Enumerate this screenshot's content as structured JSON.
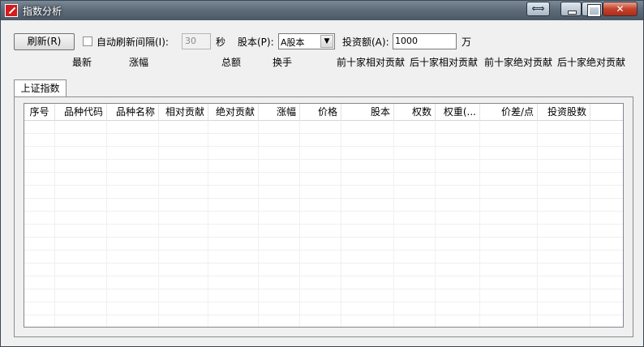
{
  "window": {
    "title": "指数分析"
  },
  "titlebar": {
    "restore_label": "⟺"
  },
  "toolbar": {
    "refresh_label": "刷新(R)",
    "auto_refresh_label": "自动刷新间隔(I):",
    "interval_value": "30",
    "seconds_label": "秒",
    "share_label": "股本(P):",
    "share_selected": "A股本",
    "invest_label": "投资额(A):",
    "invest_value": "1000",
    "unit_label": "万"
  },
  "stats": {
    "latest": "最新",
    "change": "涨幅",
    "total": "总额",
    "turnover": "换手",
    "top10_rel": "前十家相对贡献",
    "bottom10_rel": "后十家相对贡献",
    "top10_abs": "前十家绝对贡献",
    "bottom10_abs": "后十家绝对贡献"
  },
  "tabs": [
    {
      "label": "上证指数"
    }
  ],
  "table": {
    "columns": [
      "序号",
      "品种代码",
      "品种名称",
      "相对贡献",
      "绝对贡献",
      "涨幅",
      "价格",
      "股本",
      "权数",
      "权重(...",
      "价差/点",
      "投资股数"
    ],
    "rows": []
  }
}
